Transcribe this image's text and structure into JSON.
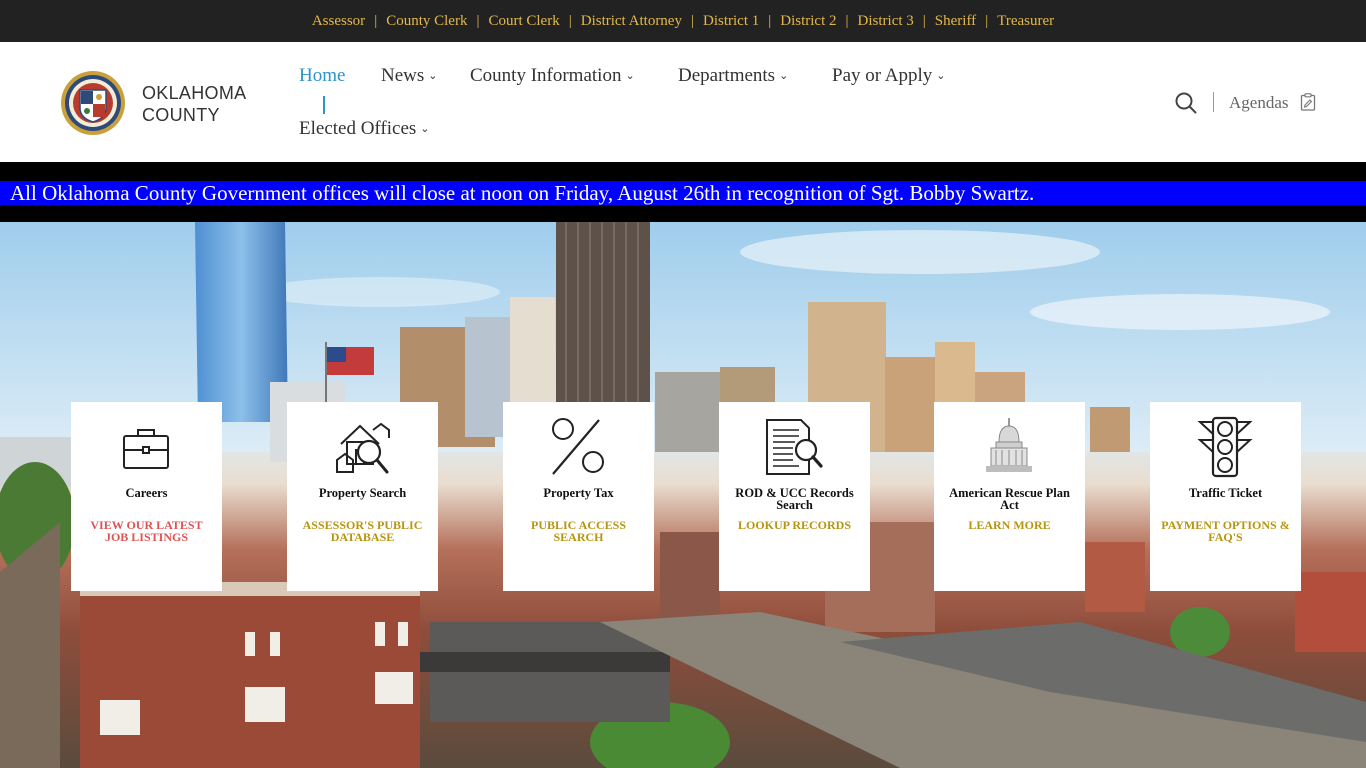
{
  "topbar": {
    "links": [
      "Assessor",
      "County Clerk",
      "Court Clerk",
      "District Attorney",
      "District 1",
      "District 2",
      "District 3",
      "Sheriff",
      "Treasurer"
    ],
    "separator": "|"
  },
  "header": {
    "logo_line1": "OKLAHOMA",
    "logo_line2": "COUNTY",
    "nav": {
      "home": "Home",
      "news": "News",
      "county_information": "County Information",
      "departments": "Departments",
      "pay_or_apply": "Pay or Apply",
      "elected_offices": "Elected Offices"
    },
    "agendas": "Agendas"
  },
  "alert": {
    "text": "All Oklahoma County Government offices will close at noon on Friday, August 26th in recognition of Sgt. Bobby Swartz."
  },
  "cards": [
    {
      "title": "Careers",
      "link": "VIEW OUR LATEST JOB LISTINGS",
      "icon": "briefcase-icon"
    },
    {
      "title": "Property Search",
      "link": "ASSESSOR'S PUBLIC DATABASE",
      "icon": "house-search-icon"
    },
    {
      "title": "Property Tax",
      "link": "PUBLIC ACCESS SEARCH",
      "icon": "percent-icon"
    },
    {
      "title": "ROD & UCC Records Search",
      "link": "LOOKUP RECORDS",
      "icon": "document-search-icon"
    },
    {
      "title": "American Rescue Plan Act",
      "link": "LEARN MORE",
      "icon": "capitol-icon"
    },
    {
      "title": "Traffic Ticket",
      "link": "PAYMENT OPTIONS & FAQ'S",
      "icon": "traffic-light-icon"
    }
  ],
  "colors": {
    "topbar_bg": "#222222",
    "topbar_link": "#e3b84a",
    "nav_active": "#2d93c8",
    "alert_bg": "#0000ff",
    "careers_link": "#e05252",
    "card_link": "#b8940f"
  }
}
